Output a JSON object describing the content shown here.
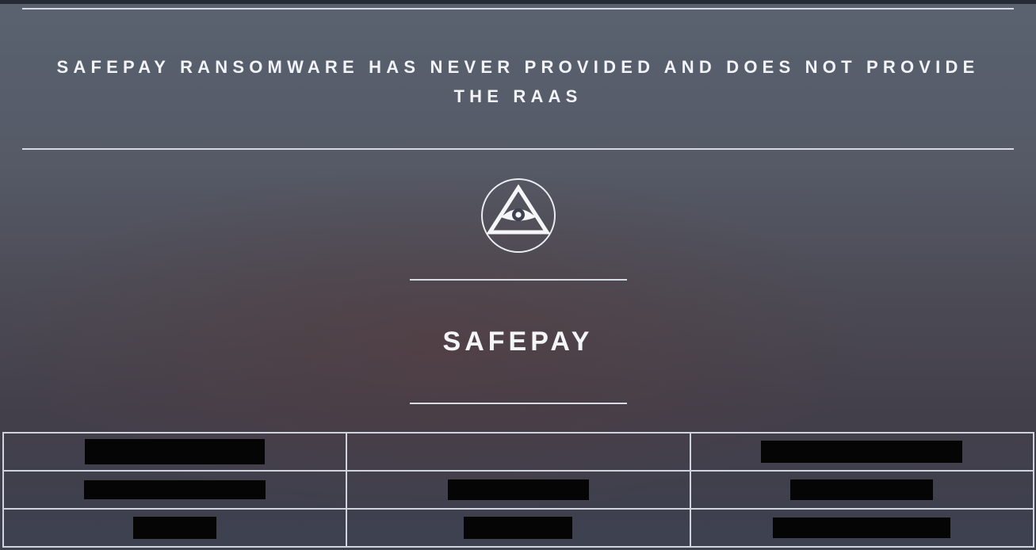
{
  "notice": {
    "text": "SAFEPAY RANSOMWARE HAS NEVER PROVIDED AND DOES NOT PROVIDE THE RAAS"
  },
  "logo": {
    "icon": "eye-in-triangle-icon"
  },
  "brand": {
    "name": "SAFEPAY"
  },
  "table": {
    "rows": [
      [
        "[redacted]",
        "",
        "[redacted]"
      ],
      [
        "[redacted]",
        "[redacted]",
        "[redacted]"
      ],
      [
        "[redacted]",
        "[redacted]",
        "[redacted]"
      ]
    ]
  },
  "colors": {
    "redaction": "#050505",
    "rule": "#d7dbe3",
    "text": "#f1f3f6"
  }
}
